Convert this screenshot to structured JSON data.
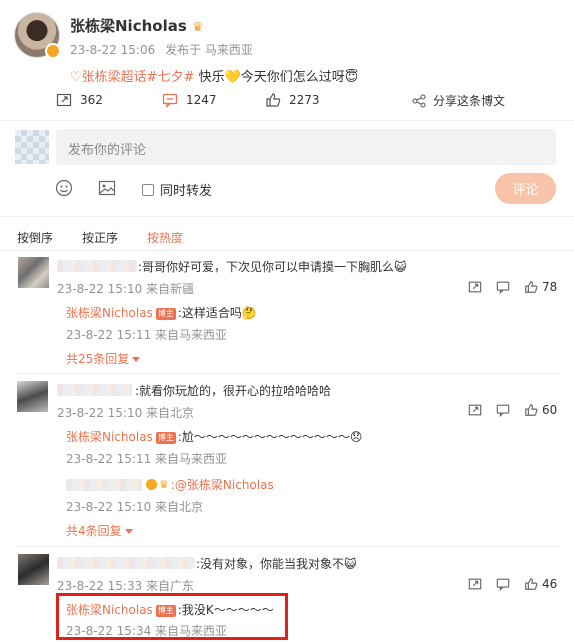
{
  "post": {
    "author": "张栋梁Nicholas",
    "time": "23-8-22 15:06",
    "location": "发布于 马来西亚",
    "topic1": "张栋梁超话",
    "topic2": "#七夕#",
    "text": " 快乐💛今天你们怎么过呀😇",
    "reposts": "362",
    "comments": "1247",
    "likes": "2273",
    "share": "分享这条博文"
  },
  "composer": {
    "placeholder": "发布你的评论",
    "repost_label": "同时转发",
    "submit": "评论"
  },
  "sort": {
    "tab1": "按倒序",
    "tab2": "按正序",
    "tab3": "按热度"
  },
  "comments": [
    {
      "text": ":哥哥你好可爱，下次见你可以申请摸一下胸肌么😺",
      "meta": "23-8-22 15:10 来自新疆",
      "likes": "78",
      "reply": {
        "author": "张栋梁Nicholas",
        "badge": "博主",
        "text": ":这样适合吗🤔",
        "meta": "23-8-22 15:11 来自马来西亚"
      },
      "more": "共25条回复"
    },
    {
      "text": ":就看你玩尬的，很开心的拉哈哈哈哈",
      "meta": "23-8-22 15:10 来自北京",
      "likes": "60",
      "reply": {
        "author": "张栋梁Nicholas",
        "badge": "博主",
        "text": ":尬～～～～～～～～～～～～～😞",
        "meta": "23-8-22 15:11 来自马来西亚"
      },
      "reply2": {
        "text": ":@张栋梁Nicholas",
        "meta": "23-8-22 15:10 来自北京"
      },
      "more": "共4条回复"
    },
    {
      "text": ":没有对象，你能当我对象不😺",
      "meta": "23-8-22 15:33 来自广东",
      "likes": "46",
      "reply": {
        "author": "张栋梁Nicholas",
        "badge": "博主",
        "text": ":我没K～～～～～",
        "meta": "23-8-22 15:34 来自马来西亚"
      }
    }
  ],
  "colors": {
    "accent": "#eb7350",
    "highlight_box": "#e0201b"
  }
}
